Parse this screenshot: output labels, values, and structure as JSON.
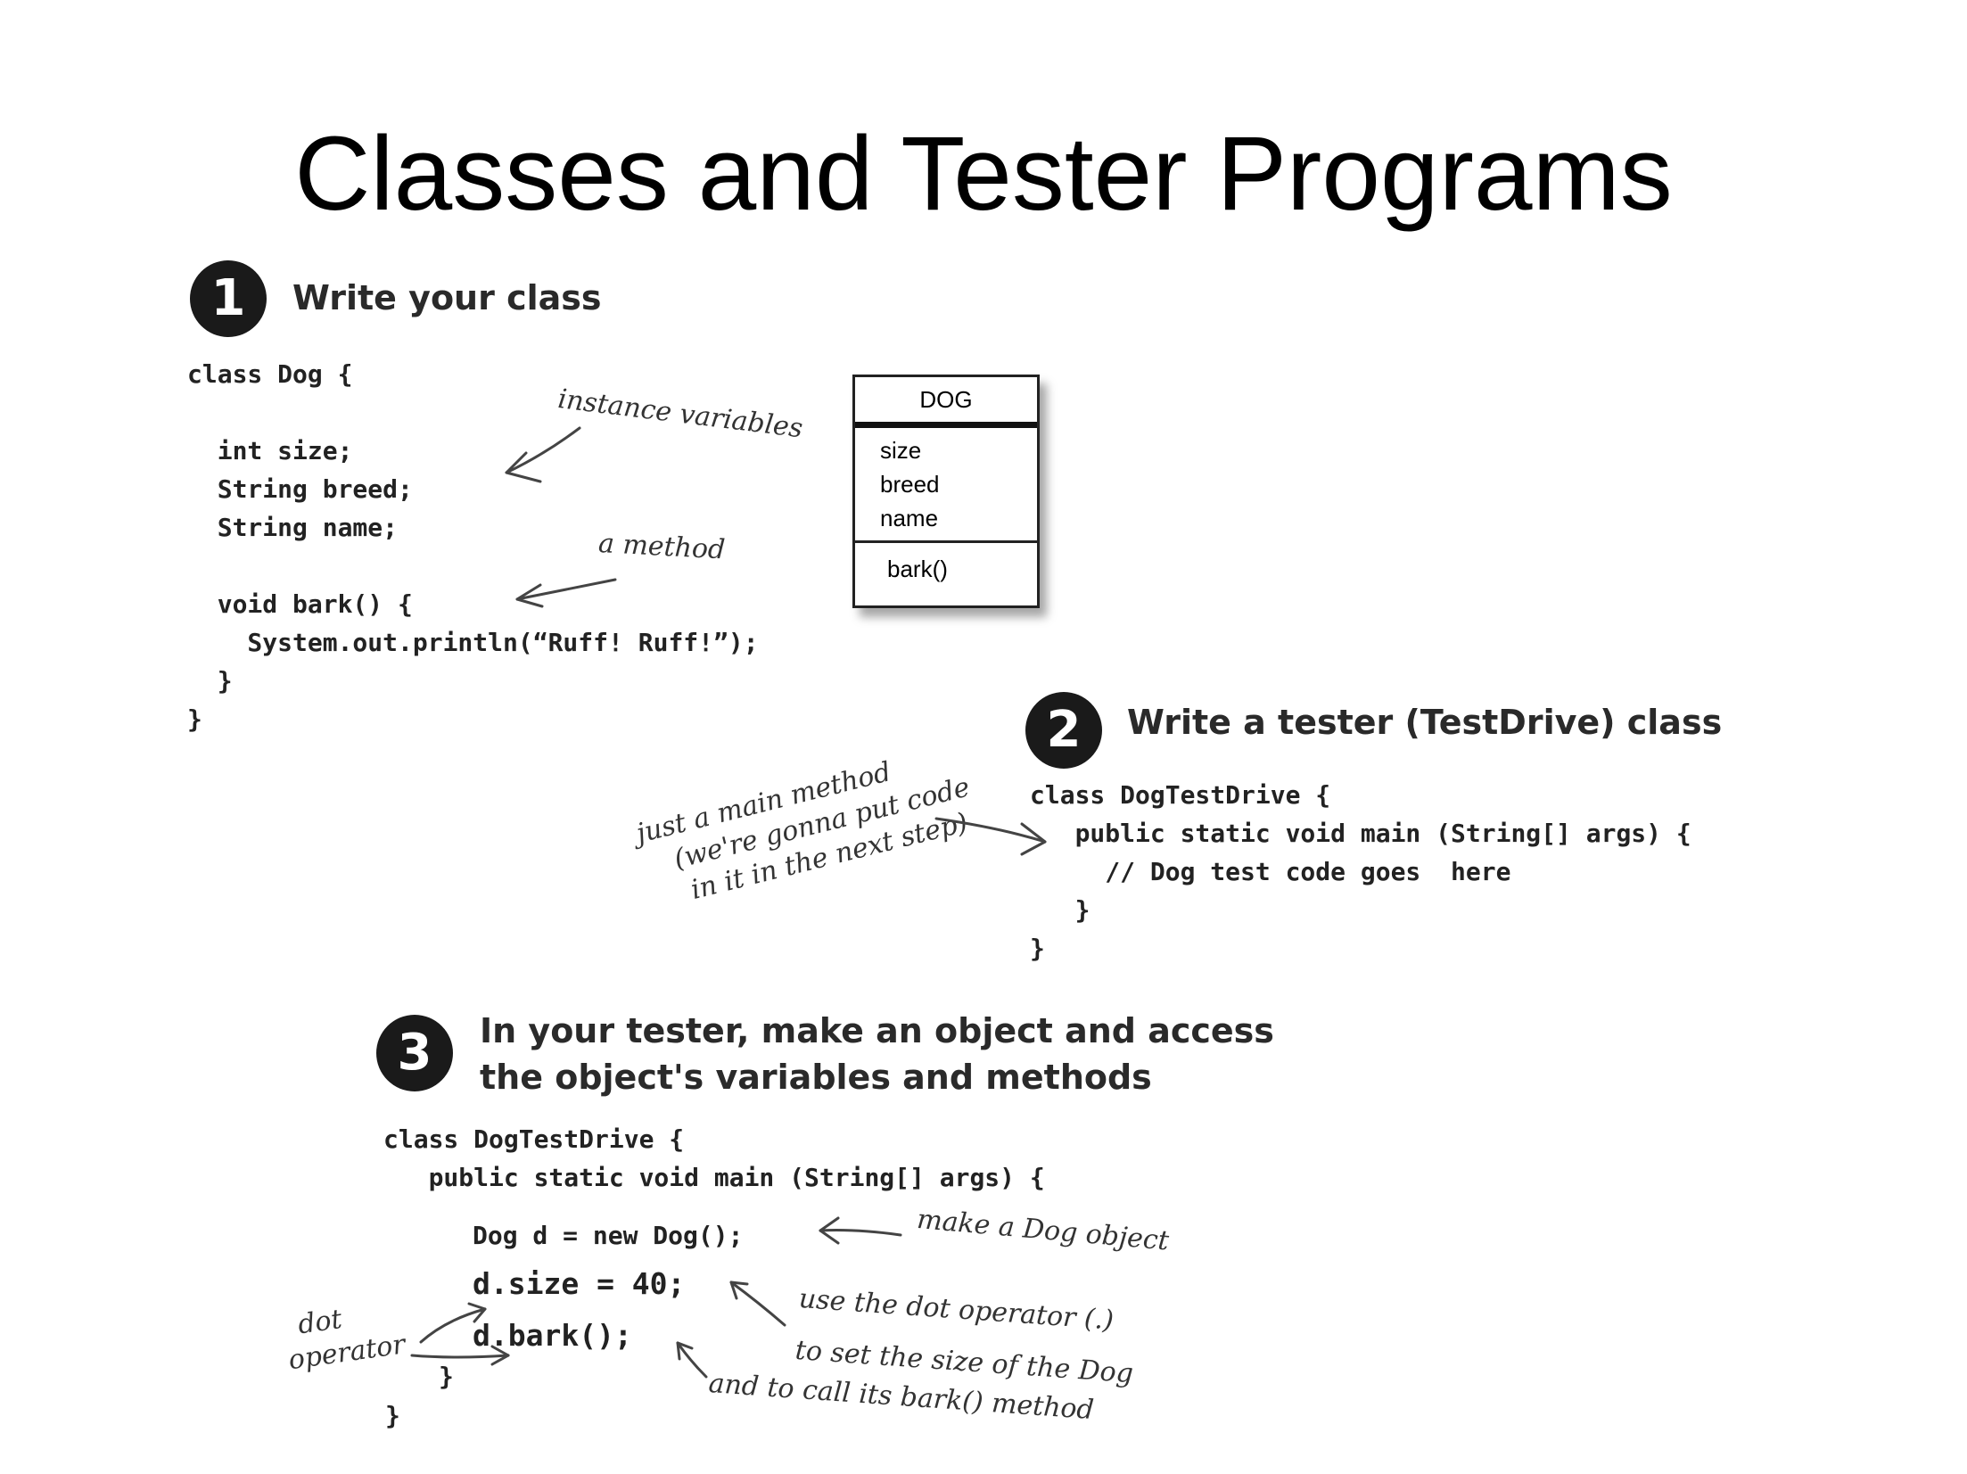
{
  "title": "Classes and Tester Programs",
  "step1": {
    "number": "1",
    "heading": "Write your class",
    "code": [
      "class Dog {",
      "",
      "  int size;",
      "  String breed;",
      "  String name;",
      "",
      "  void bark() {",
      "    System.out.println(“Ruff! Ruff!”);",
      "  }",
      "}"
    ],
    "notes": {
      "instance_variables": "instance variables",
      "a_method": "a method"
    },
    "uml": {
      "name": "DOG",
      "fields": [
        "size",
        "breed",
        "name"
      ],
      "methods": [
        "bark()"
      ]
    }
  },
  "step2": {
    "number": "2",
    "heading": "Write a tester (TestDrive) class",
    "code": [
      "class DogTestDrive {",
      "   public static void main (String[] args) {",
      "     // Dog test code goes  here",
      "   }",
      "}"
    ],
    "note_lines": [
      "just a main method",
      "(we're gonna put code",
      "in it in the next step)"
    ]
  },
  "step3": {
    "number": "3",
    "heading_lines": [
      "In your tester, make an object and access",
      "the object's variables and methods"
    ],
    "code_top": [
      "class DogTestDrive {",
      "   public static void main (String[] args) {"
    ],
    "code_new": "Dog d = new Dog();",
    "code_size": "d.size = 40;",
    "code_bark": "d.bark();",
    "code_close_inner": "}",
    "code_close_outer": "}",
    "notes": {
      "make_object": "make a Dog object",
      "dot_operator_lines": [
        "use the dot operator (.)",
        "to set the size of the Dog"
      ],
      "call_method": "and to call its bark() method",
      "dot_label_lines": [
        "dot",
        "operator"
      ]
    }
  }
}
